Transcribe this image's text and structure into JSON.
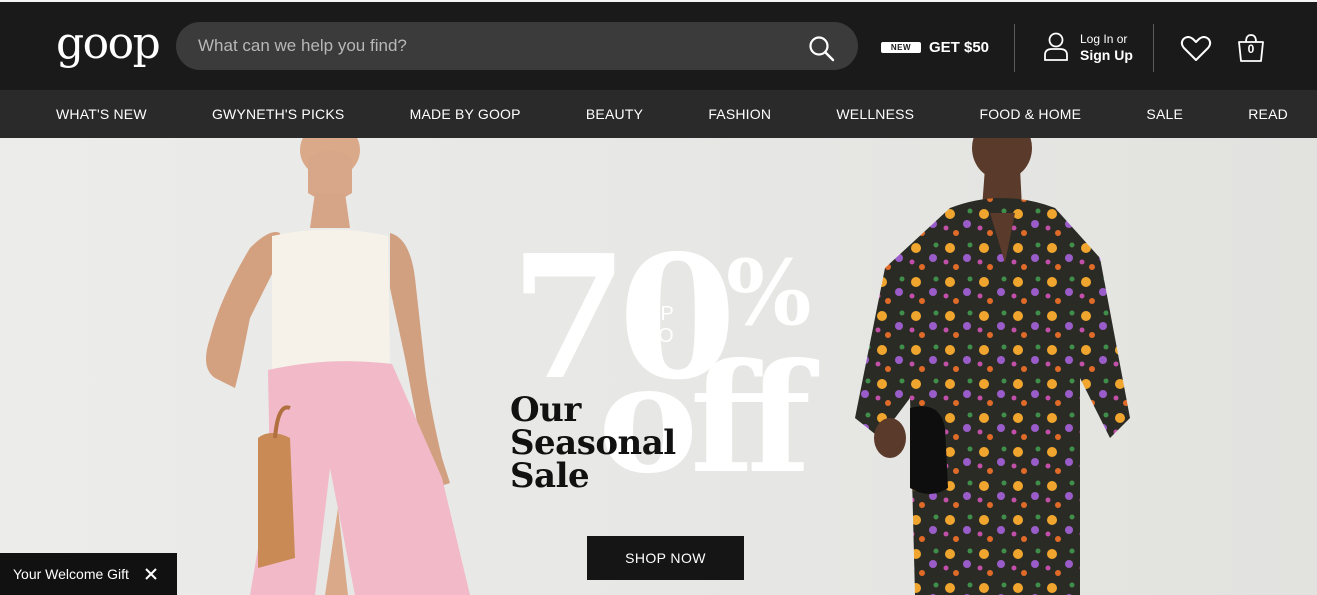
{
  "header": {
    "logo": "goop",
    "search": {
      "placeholder": "What can we help you find?",
      "value": "",
      "icon": "search-icon"
    },
    "promo": {
      "badge": "NEW",
      "label": "GET $50"
    },
    "account": {
      "line1": "Log In or",
      "line2": "Sign Up",
      "icon": "user-icon"
    },
    "wishlist": {
      "icon": "heart-icon"
    },
    "cart": {
      "icon": "shopping-bag-icon",
      "count": "0"
    }
  },
  "nav": {
    "items": [
      {
        "label": "WHAT'S NEW"
      },
      {
        "label": "GWYNETH'S PICKS"
      },
      {
        "label": "MADE BY GOOP"
      },
      {
        "label": "BEAUTY"
      },
      {
        "label": "FASHION"
      },
      {
        "label": "WELLNESS"
      },
      {
        "label": "FOOD & HOME"
      },
      {
        "label": "SALE"
      },
      {
        "label": "READ"
      }
    ]
  },
  "hero": {
    "big_number": "70",
    "percent": "%",
    "up_to_line1": "UP",
    "up_to_line2": "TO",
    "off": "off",
    "subtitle_line1": "Our",
    "subtitle_line2": "Seasonal",
    "subtitle_line3": "Sale",
    "cta": "SHOP NOW"
  },
  "welcome_gift": {
    "label": "Your Welcome Gift",
    "close_icon": "close-icon"
  },
  "colors": {
    "header_bg": "#1a1a1a",
    "nav_bg": "#2a2a2a",
    "search_bg": "#3b3b3b",
    "hero_bg": "#e8e8e6",
    "skirt_pink": "#f2b9c8",
    "button_bg": "#151515"
  }
}
